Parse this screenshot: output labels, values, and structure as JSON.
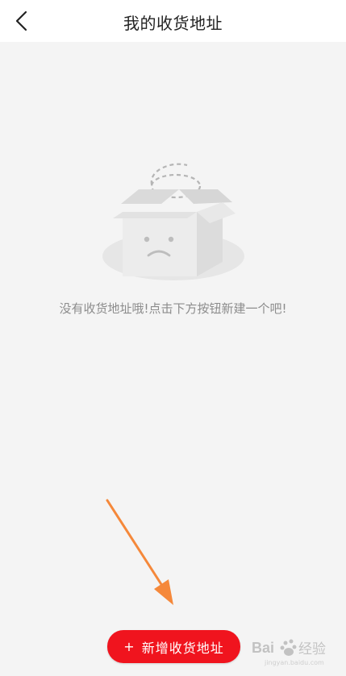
{
  "header": {
    "title": "我的收货地址",
    "back_icon": "chevron-left-icon"
  },
  "empty_state": {
    "icon": "empty-box-icon",
    "message": "没有收货地址哦!点击下方按钮新建一个吧!"
  },
  "add_button": {
    "plus": "+",
    "label": "新增收货地址"
  },
  "watermark": {
    "text": "Bai 经验",
    "icon": "baidu-paw-logo"
  },
  "colors": {
    "accent": "#f0141e",
    "annotation_arrow": "#f5883a"
  }
}
